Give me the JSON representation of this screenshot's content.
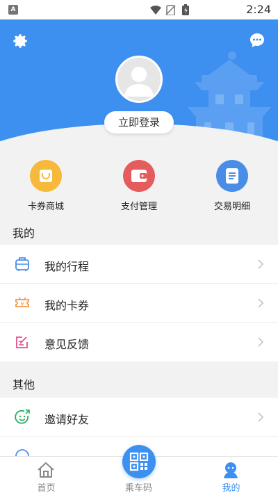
{
  "status_bar": {
    "time": "2:24",
    "app_badge": "A"
  },
  "profile": {
    "login_label": "立即登录"
  },
  "quick_actions": [
    {
      "label": "卡券商城",
      "icon": "shopping-bag-icon",
      "color": "#f6b93b"
    },
    {
      "label": "支付管理",
      "icon": "wallet-icon",
      "color": "#e55c5c"
    },
    {
      "label": "交易明细",
      "icon": "document-icon",
      "color": "#4a8de8"
    }
  ],
  "mine_section": {
    "title": "我的",
    "items": [
      {
        "label": "我的行程",
        "icon": "luggage-icon",
        "color": "#4a8de8"
      },
      {
        "label": "我的卡券",
        "icon": "ticket-icon",
        "color": "#f2994a"
      },
      {
        "label": "意见反馈",
        "icon": "feedback-icon",
        "color": "#e84e8a"
      }
    ]
  },
  "other_section": {
    "title": "其他",
    "items": [
      {
        "label": "邀请好友",
        "icon": "invite-smile-icon",
        "color": "#27ae60"
      }
    ]
  },
  "tabs": [
    {
      "label": "首页",
      "icon": "home-icon",
      "active": false
    },
    {
      "label": "乘车码",
      "icon": "qr-code-icon",
      "active": false
    },
    {
      "label": "我的",
      "icon": "profile-icon",
      "active": true
    }
  ],
  "colors": {
    "primary": "#3d8ff0",
    "background": "#f2f2f2"
  }
}
